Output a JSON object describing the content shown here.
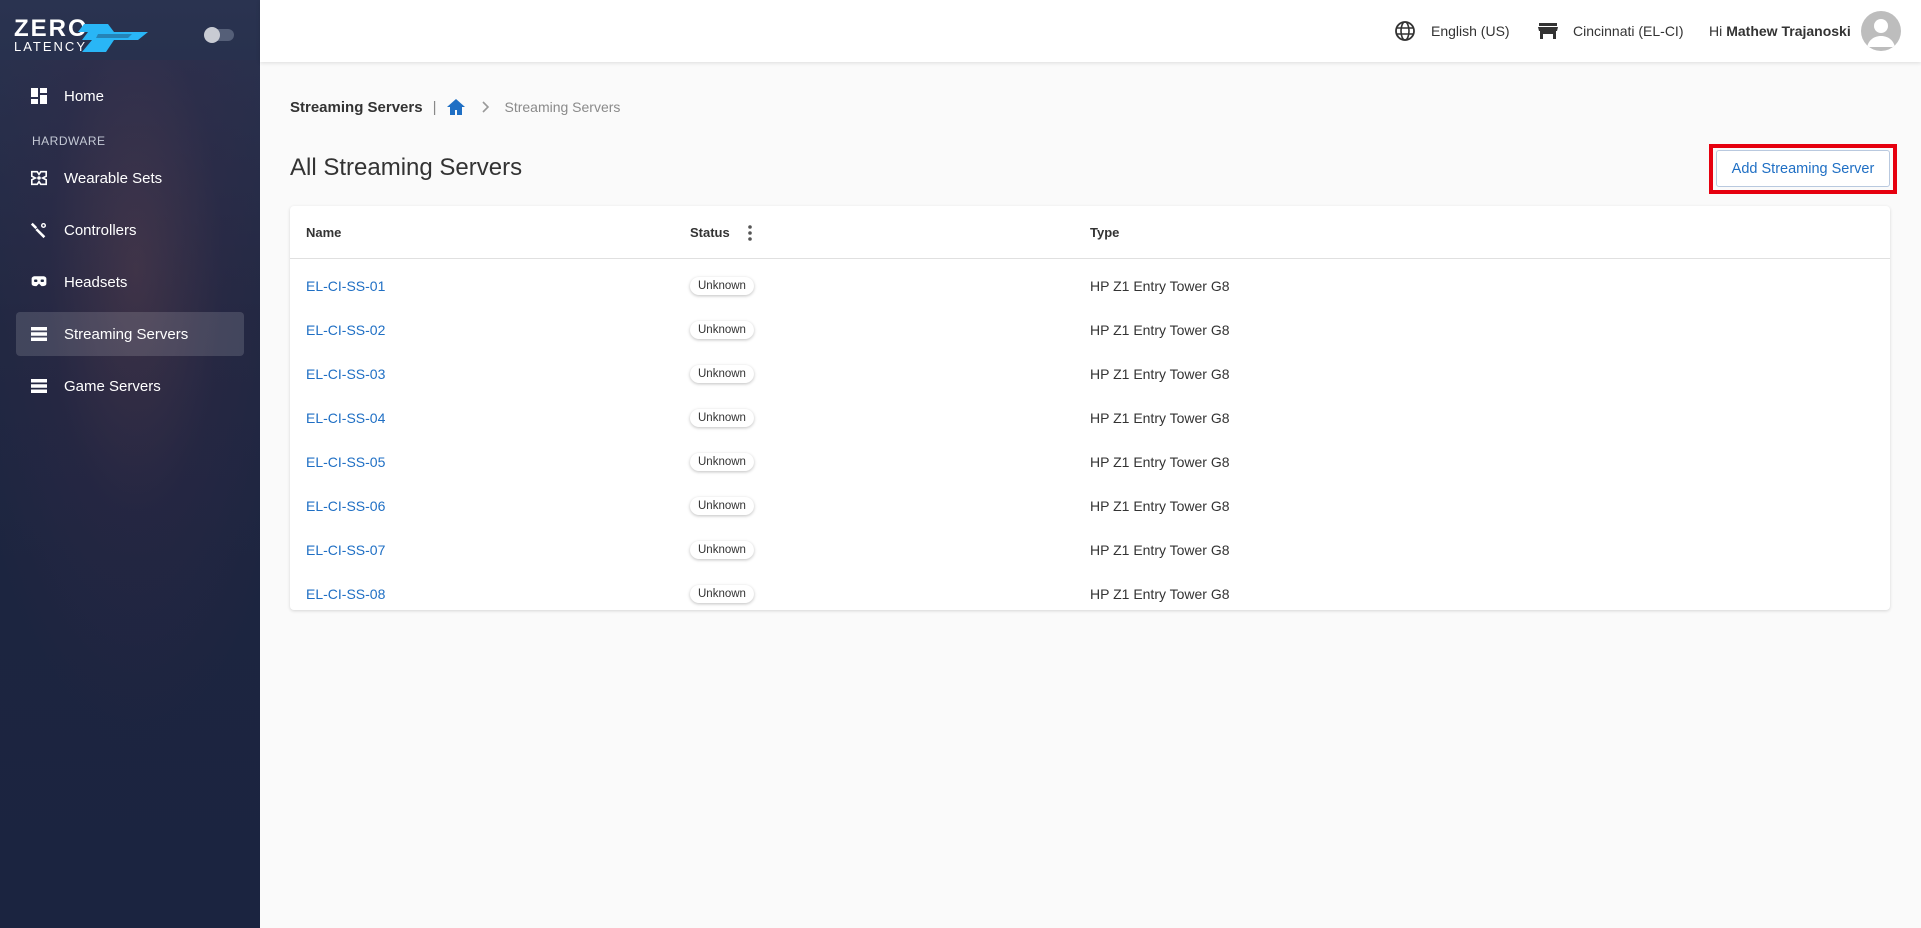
{
  "brand": {
    "line1": "ZERO",
    "line2": "LATENCY"
  },
  "sidebar": {
    "home_label": "Home",
    "section_label": "HARDWARE",
    "items": [
      {
        "label": "Wearable Sets",
        "icon": "wearable-sets-icon"
      },
      {
        "label": "Controllers",
        "icon": "controller-icon"
      },
      {
        "label": "Headsets",
        "icon": "headset-icon"
      },
      {
        "label": "Streaming Servers",
        "icon": "server-icon",
        "active": true
      },
      {
        "label": "Game Servers",
        "icon": "server-icon"
      }
    ]
  },
  "topbar": {
    "language": "English (US)",
    "location": "Cincinnati (EL-CI)",
    "greeting": "Hi",
    "user_name": "Mathew Trajanoski"
  },
  "breadcrumb": {
    "title": "Streaming Servers",
    "separator": "|",
    "current": "Streaming Servers"
  },
  "page": {
    "title": "All Streaming Servers",
    "add_button_label": "Add Streaming Server"
  },
  "table": {
    "columns": [
      "Name",
      "Status",
      "Type"
    ],
    "rows": [
      {
        "name": "EL-CI-SS-01",
        "status": "Unknown",
        "type": "HP Z1 Entry Tower G8"
      },
      {
        "name": "EL-CI-SS-02",
        "status": "Unknown",
        "type": "HP Z1 Entry Tower G8"
      },
      {
        "name": "EL-CI-SS-03",
        "status": "Unknown",
        "type": "HP Z1 Entry Tower G8"
      },
      {
        "name": "EL-CI-SS-04",
        "status": "Unknown",
        "type": "HP Z1 Entry Tower G8"
      },
      {
        "name": "EL-CI-SS-05",
        "status": "Unknown",
        "type": "HP Z1 Entry Tower G8"
      },
      {
        "name": "EL-CI-SS-06",
        "status": "Unknown",
        "type": "HP Z1 Entry Tower G8"
      },
      {
        "name": "EL-CI-SS-07",
        "status": "Unknown",
        "type": "HP Z1 Entry Tower G8"
      },
      {
        "name": "EL-CI-SS-08",
        "status": "Unknown",
        "type": "HP Z1 Entry Tower G8"
      }
    ]
  },
  "colors": {
    "sidebar_bg": "#1f2842",
    "accent_blue": "#1f6fc4",
    "highlight_red": "#e6000f",
    "brand_cyan": "#29b6f6"
  }
}
